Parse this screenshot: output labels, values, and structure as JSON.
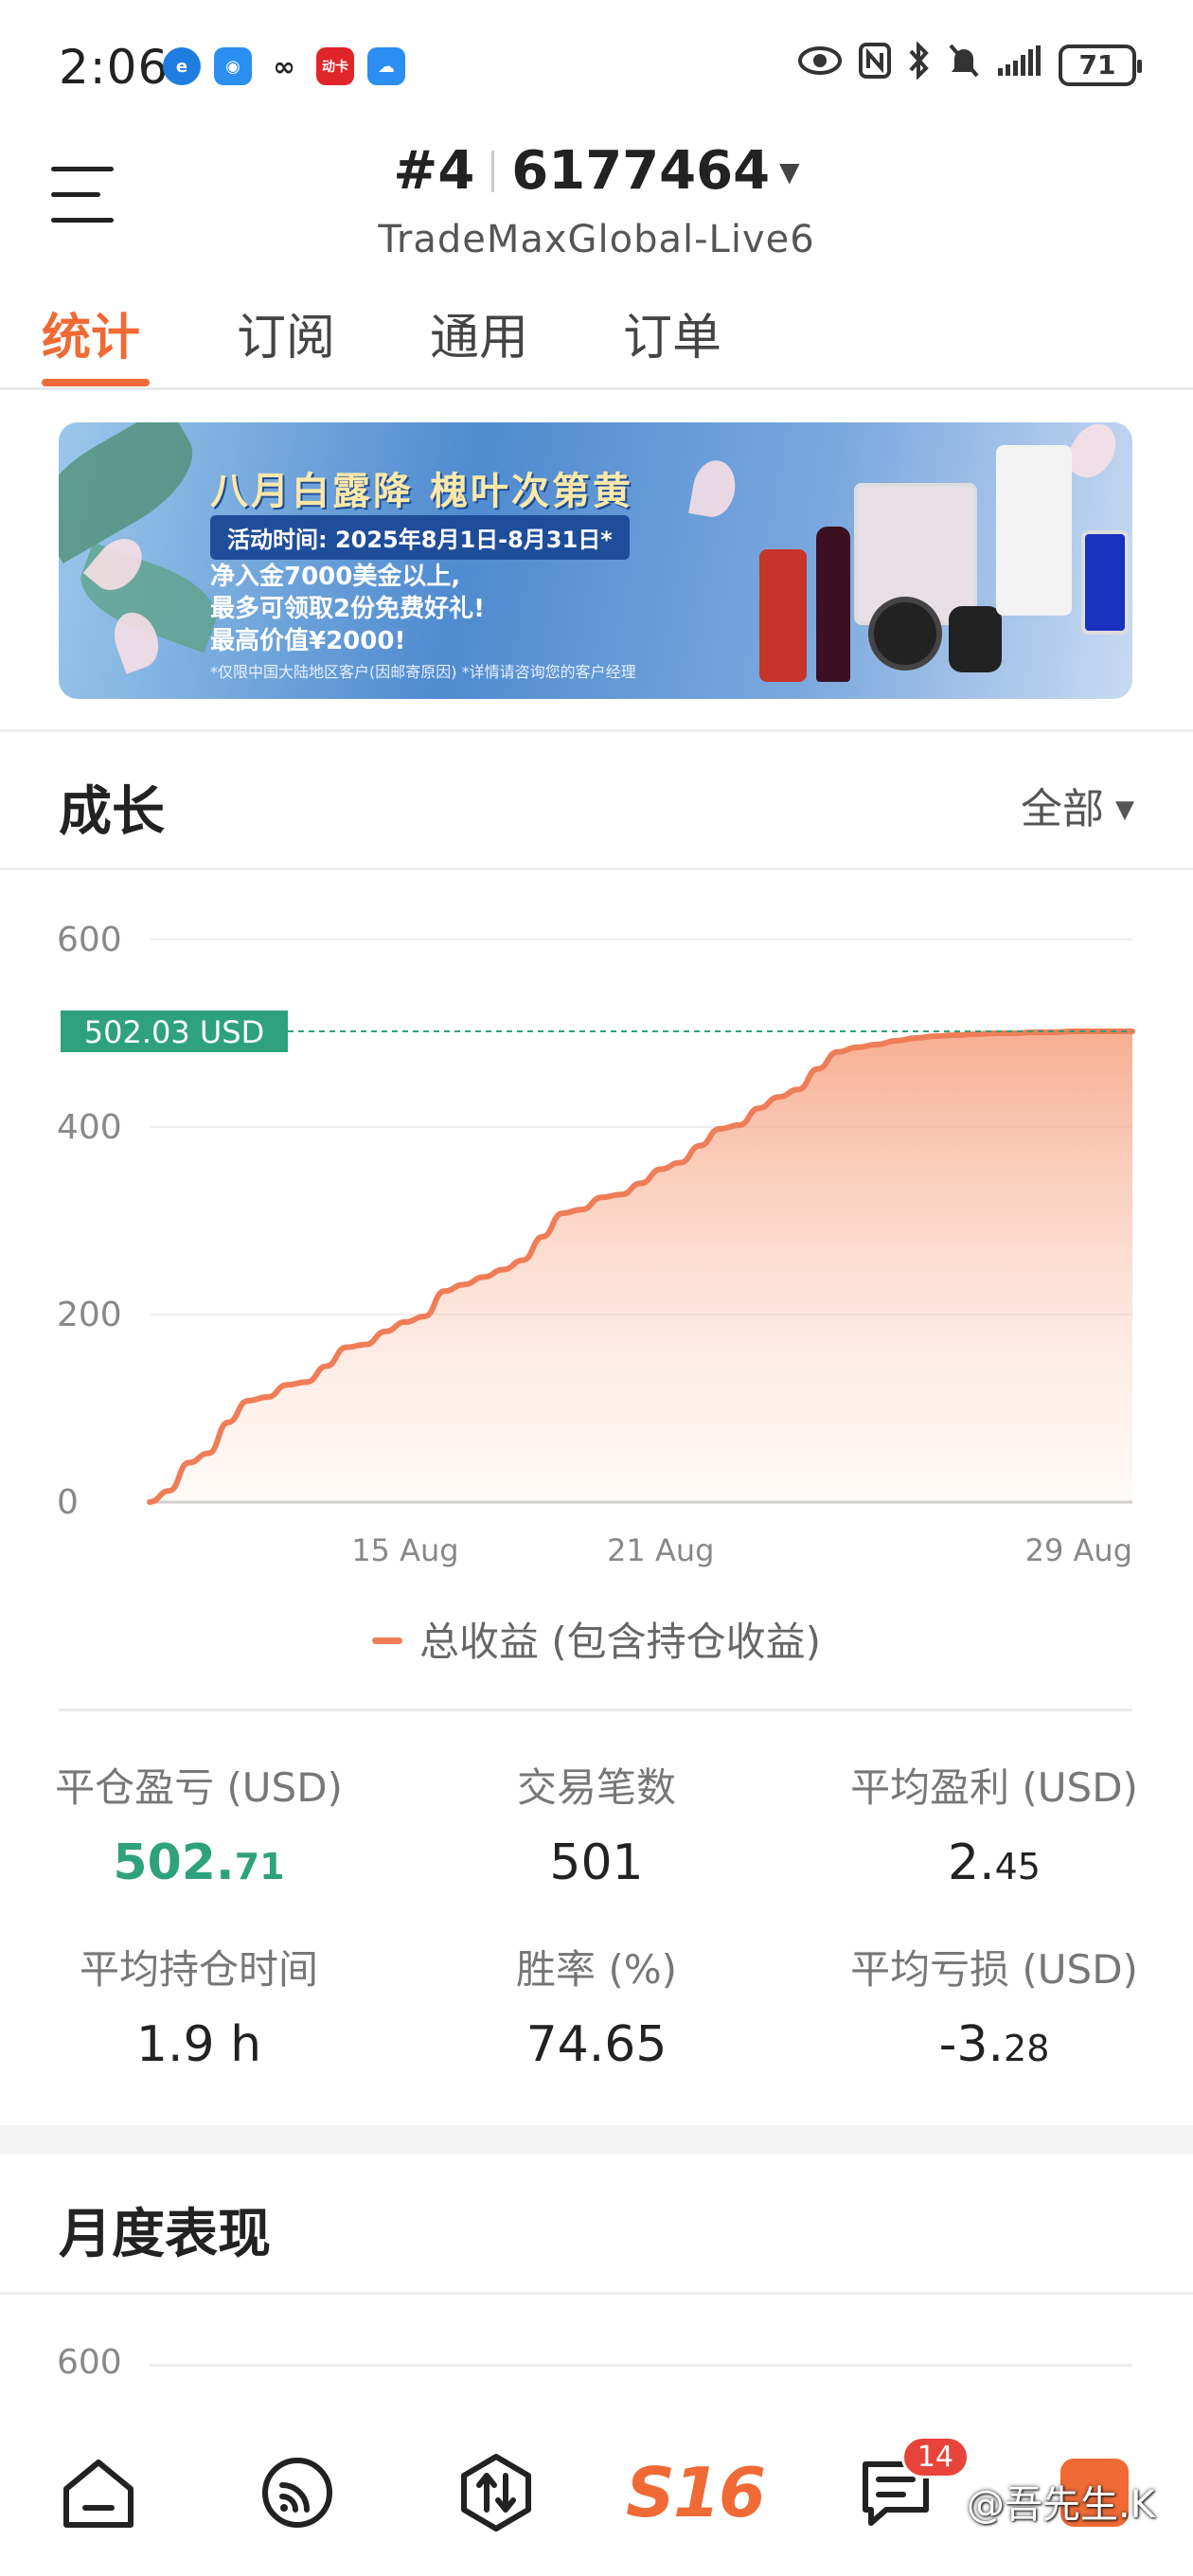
{
  "status_bar": {
    "time": "2:06",
    "battery": "71",
    "app_icons": [
      "browser-icon",
      "chat-icon",
      "link-icon",
      "news-icon",
      "cloud-icon"
    ],
    "news_icon_text": "动卡"
  },
  "header": {
    "account_prefix": "#4",
    "account_number": "6177464",
    "server": "TradeMaxGlobal-Live6"
  },
  "tabs": [
    {
      "label": "统计",
      "active": true
    },
    {
      "label": "订阅",
      "active": false
    },
    {
      "label": "通用",
      "active": false
    },
    {
      "label": "订单",
      "active": false
    }
  ],
  "banner": {
    "title": "八月白露降  槐叶次第黄",
    "period": "活动时间: 2025年8月1日-8月31日*",
    "line1": "净入金7000美金以上,",
    "line2": "最多可领取2份免费好礼!",
    "line3": "最高价值¥2000!",
    "fine_print": "*仅限中国大陆地区客户(因邮寄原因)  *详情请咨询您的客户经理"
  },
  "growth": {
    "title": "成长",
    "filter": "全部",
    "current_label": "502.03 USD",
    "legend": "总收益 (包含持仓收益)"
  },
  "chart_data": {
    "type": "area",
    "title": "",
    "xlabel": "",
    "ylabel": "",
    "ylim": [
      0,
      600
    ],
    "yticks": [
      "0",
      "200",
      "400",
      "600"
    ],
    "xticks": [
      {
        "label": "15 Aug",
        "x": 0.26
      },
      {
        "label": "21 Aug",
        "x": 0.52
      },
      {
        "label": "29 Aug",
        "x": 1.0
      }
    ],
    "series": [
      {
        "name": "总收益 (包含持仓收益)",
        "color": "#ef7d57",
        "x": [
          0,
          0.02,
          0.04,
          0.06,
          0.08,
          0.1,
          0.12,
          0.14,
          0.16,
          0.18,
          0.2,
          0.22,
          0.24,
          0.26,
          0.28,
          0.3,
          0.32,
          0.34,
          0.36,
          0.38,
          0.4,
          0.42,
          0.44,
          0.46,
          0.48,
          0.5,
          0.52,
          0.54,
          0.56,
          0.58,
          0.6,
          0.62,
          0.64,
          0.66,
          0.68,
          0.7,
          0.72,
          0.74,
          0.76,
          0.78,
          0.8,
          0.82,
          0.84,
          0.86,
          0.88,
          0.9,
          0.92,
          0.94,
          0.96,
          0.98,
          1.0
        ],
        "values": [
          0,
          12,
          42,
          52,
          85,
          108,
          112,
          125,
          128,
          145,
          165,
          168,
          182,
          192,
          198,
          225,
          232,
          240,
          248,
          258,
          283,
          308,
          312,
          325,
          328,
          340,
          355,
          362,
          380,
          398,
          402,
          420,
          432,
          440,
          462,
          480,
          485,
          488,
          492,
          495,
          497,
          498,
          499,
          500,
          500,
          501,
          501,
          502,
          502,
          502,
          502.03
        ]
      }
    ],
    "reference_line": {
      "value": 502.03,
      "label": "502.03 USD",
      "color": "#2ea17d"
    },
    "grid": true
  },
  "stats": {
    "closed_pnl_label": "平仓盈亏 (USD)",
    "closed_pnl_int": "502.",
    "closed_pnl_dec": "71",
    "trades_label": "交易笔数",
    "trades_value": "501",
    "avg_profit_label": "平均盈利 (USD)",
    "avg_profit_int": "2.",
    "avg_profit_dec": "45",
    "avg_hold_label": "平均持仓时间",
    "avg_hold_value": "1.9 h",
    "win_rate_label": "胜率 (%)",
    "win_rate_value": "74.65",
    "avg_loss_label": "平均亏损 (USD)",
    "avg_loss_int": "-3.",
    "avg_loss_dec": "28"
  },
  "monthly": {
    "title": "月度表现",
    "y_top": "600"
  },
  "bottom_nav": {
    "s16_label": "S16",
    "messages_badge": "14",
    "watermark": "@吾先生.K"
  }
}
